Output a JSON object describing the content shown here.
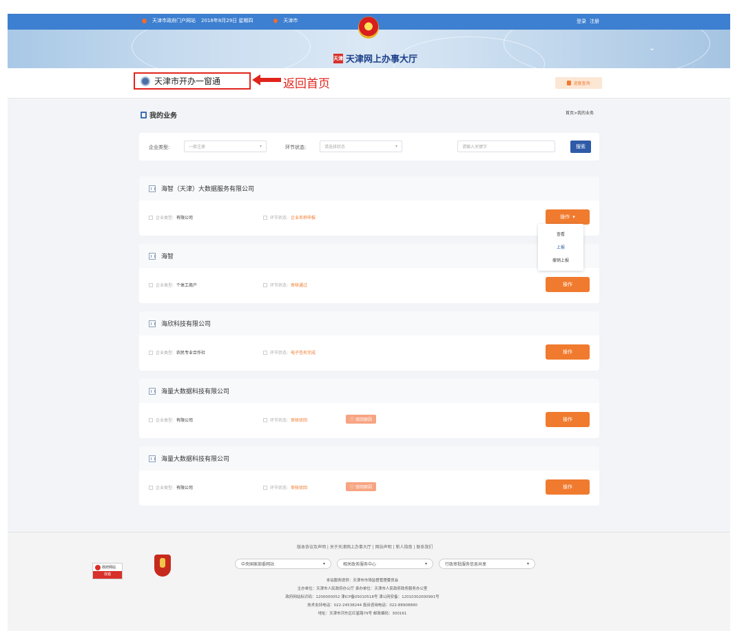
{
  "topbar": {
    "portal": "天津市政府门户网站",
    "date": "2018年8月29日 星期四",
    "city": "天津市",
    "login": "登录",
    "register": "注册"
  },
  "banner": {
    "title": "天津网上办事大厅",
    "logo": "天津"
  },
  "subheader": {
    "home_link": "天津市开办一窗通",
    "back_label": "返回首页",
    "query_button": "进度查询"
  },
  "main": {
    "title": "我的业务",
    "breadcrumb": "首页>我的业务",
    "filter": {
      "type_label": "企业类型:",
      "type_value": "一般注册",
      "status_label": "环节状态:",
      "status_value": "请选择状态",
      "search_placeholder": "请输入关键字",
      "search_button": "搜索"
    },
    "type_label": "企业类型:",
    "status_label": "环节状态:",
    "op_label": "操作",
    "cards": [
      {
        "name": "海智（天津）大数据服务有限公司",
        "type": "有限公司",
        "status": "企业名称申报",
        "tag": ""
      },
      {
        "name": "海智",
        "type": "个体工商户",
        "status": "审核通过",
        "tag": ""
      },
      {
        "name": "海欣科技有限公司",
        "type": "农民专业合作社",
        "status": "电子签名完成",
        "tag": ""
      },
      {
        "name": "海量大数据科技有限公司",
        "type": "有限公司",
        "status": "审核驳回",
        "tag": "驳回原因"
      },
      {
        "name": "海量大数据科技有限公司",
        "type": "有限公司",
        "status": "审核驳回",
        "tag": "驳回原因"
      }
    ],
    "dropdown": [
      "查看",
      "上报",
      "撤销上报"
    ]
  },
  "footer": {
    "links": "版本协议及声明 | 关于天津网上办事大厅 | 网站声明 | 新人指南 | 联系我们",
    "badge_top": "政府网站",
    "badge_bottom": "找错",
    "selects": [
      "中央国家部委网站",
      "相关政务服务中心",
      "行政审批服务信息共享"
    ],
    "lines": [
      "本站服务提供：天津市市场监督管理委员会",
      "主办单位：天津市人民政府办公厅 承办单位：天津市人民政府政务服务办公室",
      "政府网站标识码：1200000052 津ICP备05010518号 津公网安备：12010302000991号",
      "技术支持电话：022-24538244 投诉咨询电话：022-88908890",
      "地址：天津市河东区红星路79号 邮政编码：300161"
    ]
  }
}
